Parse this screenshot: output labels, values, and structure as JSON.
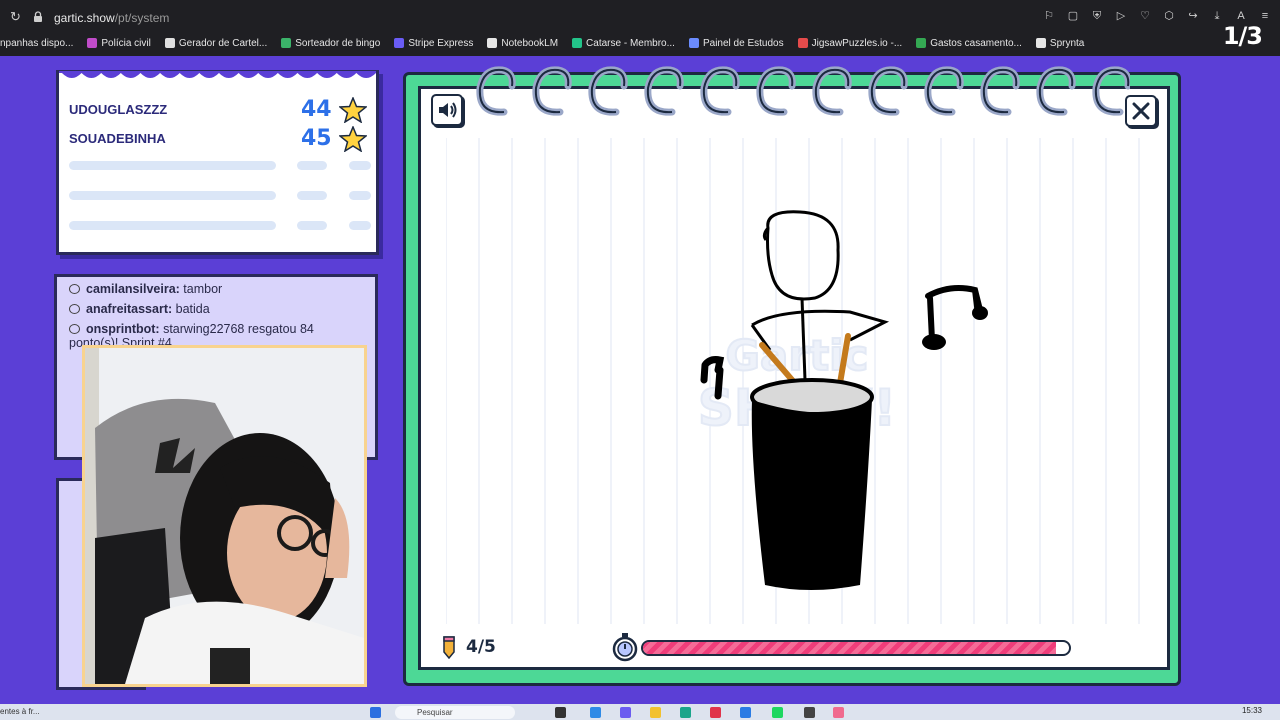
{
  "browser": {
    "url_host": "gartic.show",
    "url_path": "/pt/system",
    "bookmarks": [
      {
        "label": "npanhas dispo...",
        "color": "#e6e6e6"
      },
      {
        "label": "Polícia civil",
        "color": "#c04cc9"
      },
      {
        "label": "Gerador de Cartel...",
        "color": "#e0e0e0"
      },
      {
        "label": "Sorteador de bingo",
        "color": "#3bb36a"
      },
      {
        "label": "Stripe Express",
        "color": "#6a5cf5"
      },
      {
        "label": "NotebookLM",
        "color": "#e6e6e6"
      },
      {
        "label": "Catarse - Membro...",
        "color": "#23c48a"
      },
      {
        "label": "Painel de Estudos",
        "color": "#6b8cff"
      },
      {
        "label": "JigsawPuzzles.io -...",
        "color": "#e54b4b"
      },
      {
        "label": "Gastos casamento...",
        "color": "#34a853"
      },
      {
        "label": "Sprynta",
        "color": "#e6e6e6"
      }
    ],
    "overlay_counter": "1/3"
  },
  "scoreboard": {
    "players": [
      {
        "name": "UDOUGLASZZZ",
        "points": "44"
      },
      {
        "name": "SOUADEBINHA",
        "points": "45"
      }
    ]
  },
  "chat": {
    "messages": [
      {
        "user": "camilansilveira:",
        "text": "tambor"
      },
      {
        "user": "anafreitassart:",
        "text": "batida"
      },
      {
        "user": "onsprintbot:",
        "text": "starwing22768 resgatou 84"
      },
      {
        "user": "",
        "text": "ponto(s)! Sprint #4"
      }
    ]
  },
  "game": {
    "round": "4/5",
    "timer_remaining": 0.97,
    "accent": "#4dd896",
    "timer_color": "#ef3d7a"
  },
  "taskbar": {
    "left_text": "entes à fr...",
    "search_placeholder": "Pesquisar",
    "time": "15:33"
  }
}
